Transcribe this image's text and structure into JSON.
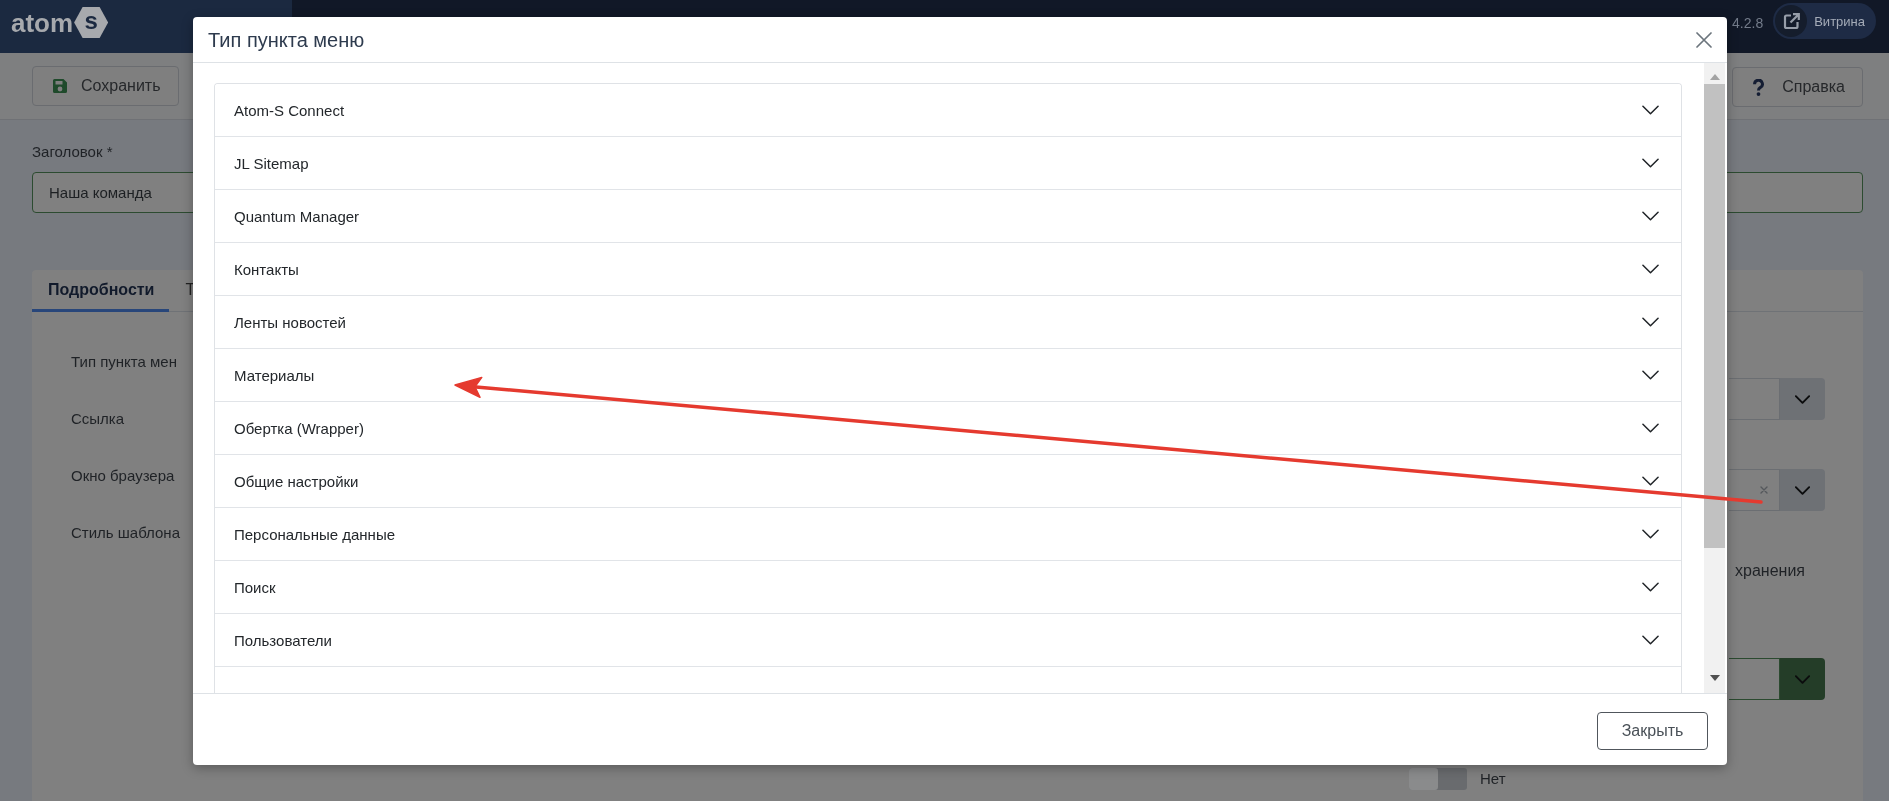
{
  "header": {
    "logo": {
      "text": "atom",
      "badge": "s"
    },
    "version": "4.2.8",
    "site_button": "Витрина"
  },
  "toolbar": {
    "buttons": [
      {
        "kind": "save",
        "label": "Сохранить"
      },
      {
        "kind": "help",
        "label": "Справка"
      }
    ]
  },
  "form": {
    "title_field": {
      "label": "Заголовок *",
      "value": "Наша команда",
      "valid": true
    },
    "tabs": [
      {
        "label": "Подробности",
        "selected": true
      },
      {
        "label": "Т",
        "selected": false
      }
    ],
    "labels": [
      "Тип пункта мен",
      "Ссылка",
      "Окно браузера",
      "Стиль шаблона"
    ],
    "side_controls": [
      {
        "kind": "select",
        "clearable": false,
        "valid": false
      },
      {
        "kind": "select",
        "clearable": true,
        "valid": false
      },
      {
        "kind": "text",
        "text": "хранения"
      },
      {
        "kind": "select",
        "clearable": false,
        "valid": true
      },
      {
        "kind": "toggle",
        "label": "Нет",
        "on": false
      }
    ]
  },
  "modal": {
    "title": "Тип пункта меню",
    "items": [
      {
        "label": "Atom-S Connect",
        "expanded": false
      },
      {
        "label": "JL Sitemap",
        "expanded": false
      },
      {
        "label": "Quantum Manager",
        "expanded": false
      },
      {
        "label": "Контакты",
        "expanded": false
      },
      {
        "label": "Ленты новостей",
        "expanded": false
      },
      {
        "label": "Материалы",
        "expanded": false
      },
      {
        "label": "Обертка (Wrapper)",
        "expanded": false
      },
      {
        "label": "Общие настройки",
        "expanded": false
      },
      {
        "label": "Персональные данные",
        "expanded": false
      },
      {
        "label": "Поиск",
        "expanded": false
      },
      {
        "label": "Пользователи",
        "expanded": false
      }
    ],
    "close_button": "Закрыть"
  },
  "annotation": {
    "kind": "arrow"
  }
}
